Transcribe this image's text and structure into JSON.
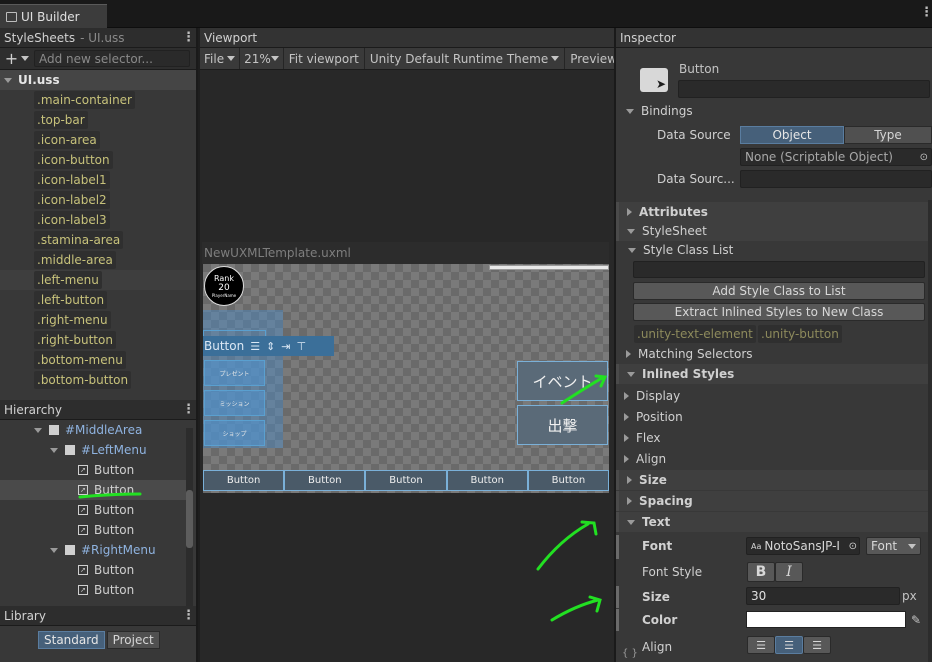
{
  "window": {
    "tab_title": "UI Builder"
  },
  "stylesheets": {
    "title": "StyleSheets",
    "file": "- UI.uss",
    "add_placeholder": "Add new selector...",
    "root": "UI.uss",
    "selectors": [
      ".main-container",
      ".top-bar",
      ".icon-area",
      ".icon-button",
      ".icon-label1",
      ".icon-label2",
      ".icon-label3",
      ".stamina-area",
      ".middle-area",
      ".left-menu",
      ".left-button",
      ".right-menu",
      ".right-button",
      ".bottom-menu",
      ".bottom-button"
    ]
  },
  "hierarchy": {
    "title": "Hierarchy",
    "rows": [
      {
        "label": "#MiddleArea",
        "kind": "container"
      },
      {
        "label": "#LeftMenu",
        "kind": "container"
      },
      {
        "label": "Button",
        "kind": "button"
      },
      {
        "label": "Button",
        "kind": "button"
      },
      {
        "label": "Button",
        "kind": "button"
      },
      {
        "label": "Button",
        "kind": "button"
      },
      {
        "label": "#RightMenu",
        "kind": "container"
      },
      {
        "label": "Button",
        "kind": "button"
      },
      {
        "label": "Button",
        "kind": "button"
      }
    ]
  },
  "library": {
    "title": "Library",
    "tabs": [
      "Standard",
      "Project"
    ]
  },
  "viewport": {
    "title": "Viewport",
    "toolbar": {
      "file": "File",
      "zoom": "21%",
      "fit": "Fit viewport",
      "theme": "Unity Default Runtime Theme",
      "preview": "Preview"
    },
    "document": "NewUXMLTemplate.uxml",
    "rank": {
      "label": "Rank",
      "value": "20",
      "name": "PlayerName"
    },
    "selected_button": "Button",
    "left_buttons": [
      "プレゼント",
      "ミッション",
      "ショップ"
    ],
    "right_buttons": [
      "イベント",
      "出撃"
    ],
    "bottom_buttons": [
      "Button",
      "Button",
      "Button",
      "Button",
      "Button"
    ]
  },
  "inspector": {
    "title": "Inspector",
    "element_type": "Button",
    "bindings": "Bindings",
    "data_source_label": "Data Source",
    "toggle": [
      "Object",
      "Type"
    ],
    "data_source_value": "None (Scriptable Object)",
    "data_source_path_label": "Data Sourc...",
    "attributes": "Attributes",
    "stylesheet": "StyleSheet",
    "style_class_list": "Style Class List",
    "add_class_btn": "Add Style Class to List",
    "extract_btn": "Extract Inlined Styles to New Class",
    "classes": [
      ".unity-text-element",
      ".unity-button"
    ],
    "matching": "Matching Selectors",
    "inlined": "Inlined Styles",
    "sections": [
      "Display",
      "Position",
      "Flex",
      "Align"
    ],
    "size": "Size",
    "spacing": "Spacing",
    "text": "Text",
    "font_label": "Font",
    "font_value": "NotoSansJP-I",
    "font_dropdown": "Font",
    "font_style_label": "Font Style",
    "font_style_buttons": [
      "B",
      "I"
    ],
    "size_label": "Size",
    "size_value": "30",
    "size_unit": "px",
    "color_label": "Color",
    "color_value": "#ffffff",
    "align_label": "Align",
    "footer": "{ }"
  }
}
